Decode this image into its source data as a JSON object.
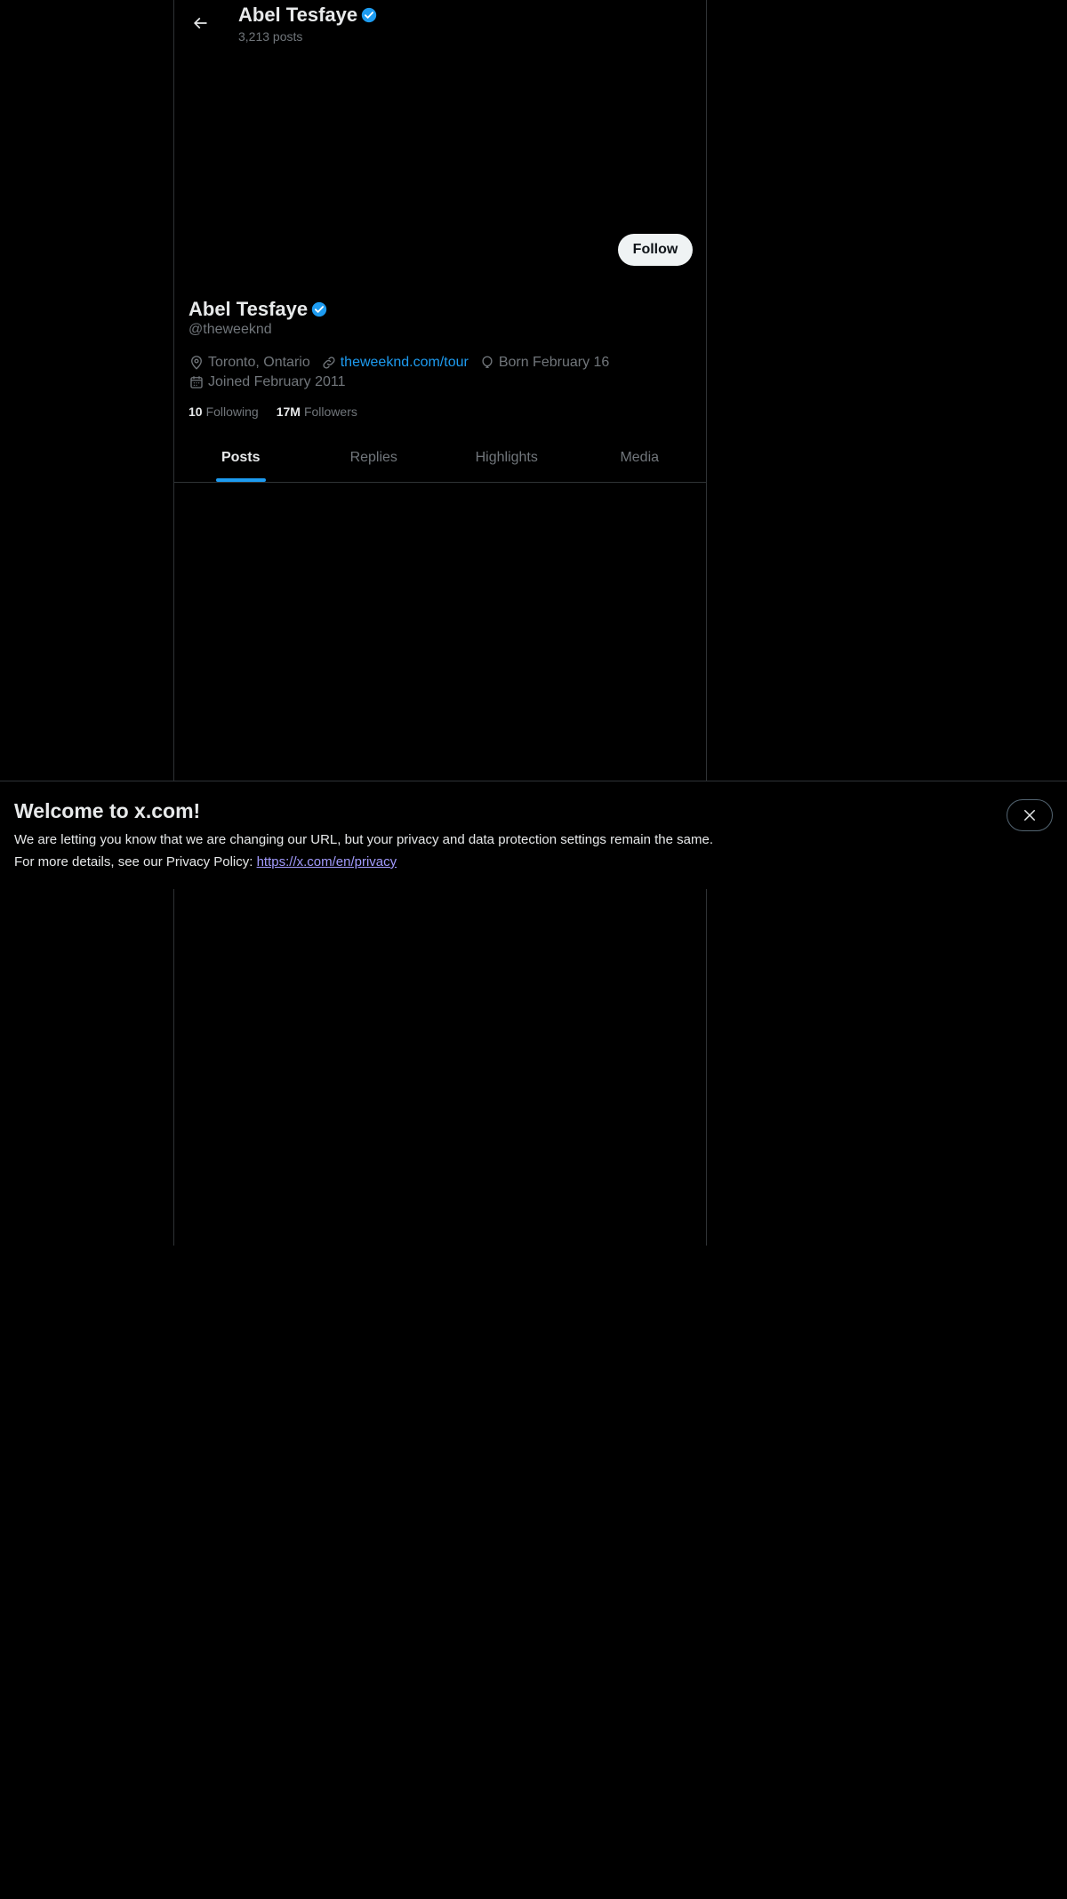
{
  "header": {
    "name": "Abel Tesfaye",
    "posts_count": "3,213 posts",
    "back_icon": "arrow-left-icon",
    "verified_icon": "verified-badge-icon"
  },
  "profile": {
    "name": "Abel Tesfaye",
    "handle": "@theweeknd",
    "follow_label": "Follow",
    "location": "Toronto, Ontario",
    "website": "theweeknd.com/tour",
    "birthday": "Born February 16",
    "joined": "Joined February 2011",
    "following_count": "10",
    "following_label": "Following",
    "followers_count": "17M",
    "followers_label": "Followers"
  },
  "tabs": [
    {
      "label": "Posts",
      "active": true
    },
    {
      "label": "Replies",
      "active": false
    },
    {
      "label": "Highlights",
      "active": false
    },
    {
      "label": "Media",
      "active": false
    }
  ],
  "banner": {
    "title": "Welcome to x.com!",
    "line1": "We are letting you know that we are changing our URL, but your privacy and data protection settings remain the same.",
    "line2_prefix": "For more details, see our Privacy Policy: ",
    "link": "https://x.com/en/privacy",
    "close_icon": "close-icon"
  },
  "colors": {
    "background": "#000000",
    "accent": "#1d9bf0",
    "text_primary": "#e7e9ea",
    "text_secondary": "#71767b",
    "border": "#2f3336",
    "privacy_link": "#a29bfe"
  }
}
